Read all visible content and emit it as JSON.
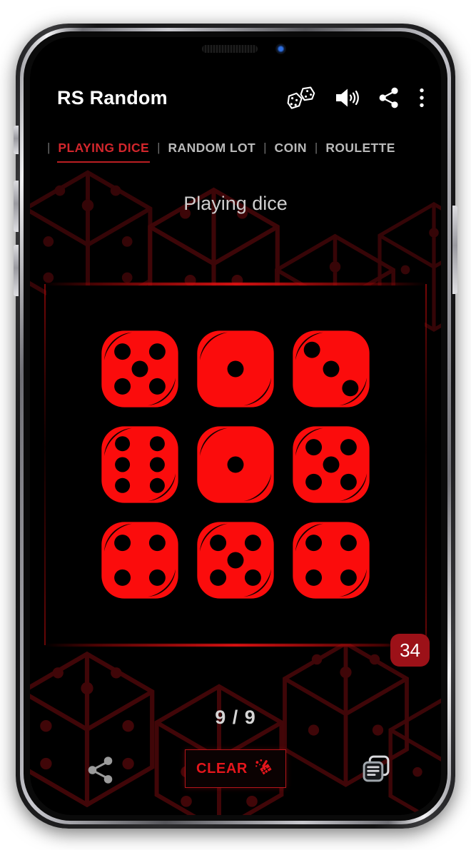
{
  "app": {
    "title": "RS Random",
    "screen_title": "Playing dice",
    "accent_red": "#e5161c",
    "badge_red": "#9c1118",
    "background": "#000000"
  },
  "app_bar": {
    "icons": [
      {
        "name": "dice-icon",
        "label": "Dice"
      },
      {
        "name": "volume-icon",
        "label": "Sound"
      },
      {
        "name": "share-icon",
        "label": "Share"
      },
      {
        "name": "overflow-menu-icon",
        "label": "More options"
      }
    ]
  },
  "tabs": {
    "separator": "|",
    "items": [
      {
        "label": "PLAYING DICE",
        "active": true
      },
      {
        "label": "RANDOM LOT",
        "active": false
      },
      {
        "label": "COIN",
        "active": false
      },
      {
        "label": "ROULETTE",
        "active": false
      }
    ]
  },
  "dice": {
    "values": [
      5,
      1,
      3,
      6,
      1,
      5,
      4,
      5,
      4
    ],
    "sum_badge": "34",
    "counter": "9 / 9",
    "face_color": "#fb0c0c",
    "pip_color": "#000000"
  },
  "bottom_bar": {
    "share_label": "Share",
    "clear_label": "CLEAR",
    "clear_icon": "broom-icon",
    "copy_label": "Copy",
    "copy_icon": "copy-documents-icon"
  }
}
